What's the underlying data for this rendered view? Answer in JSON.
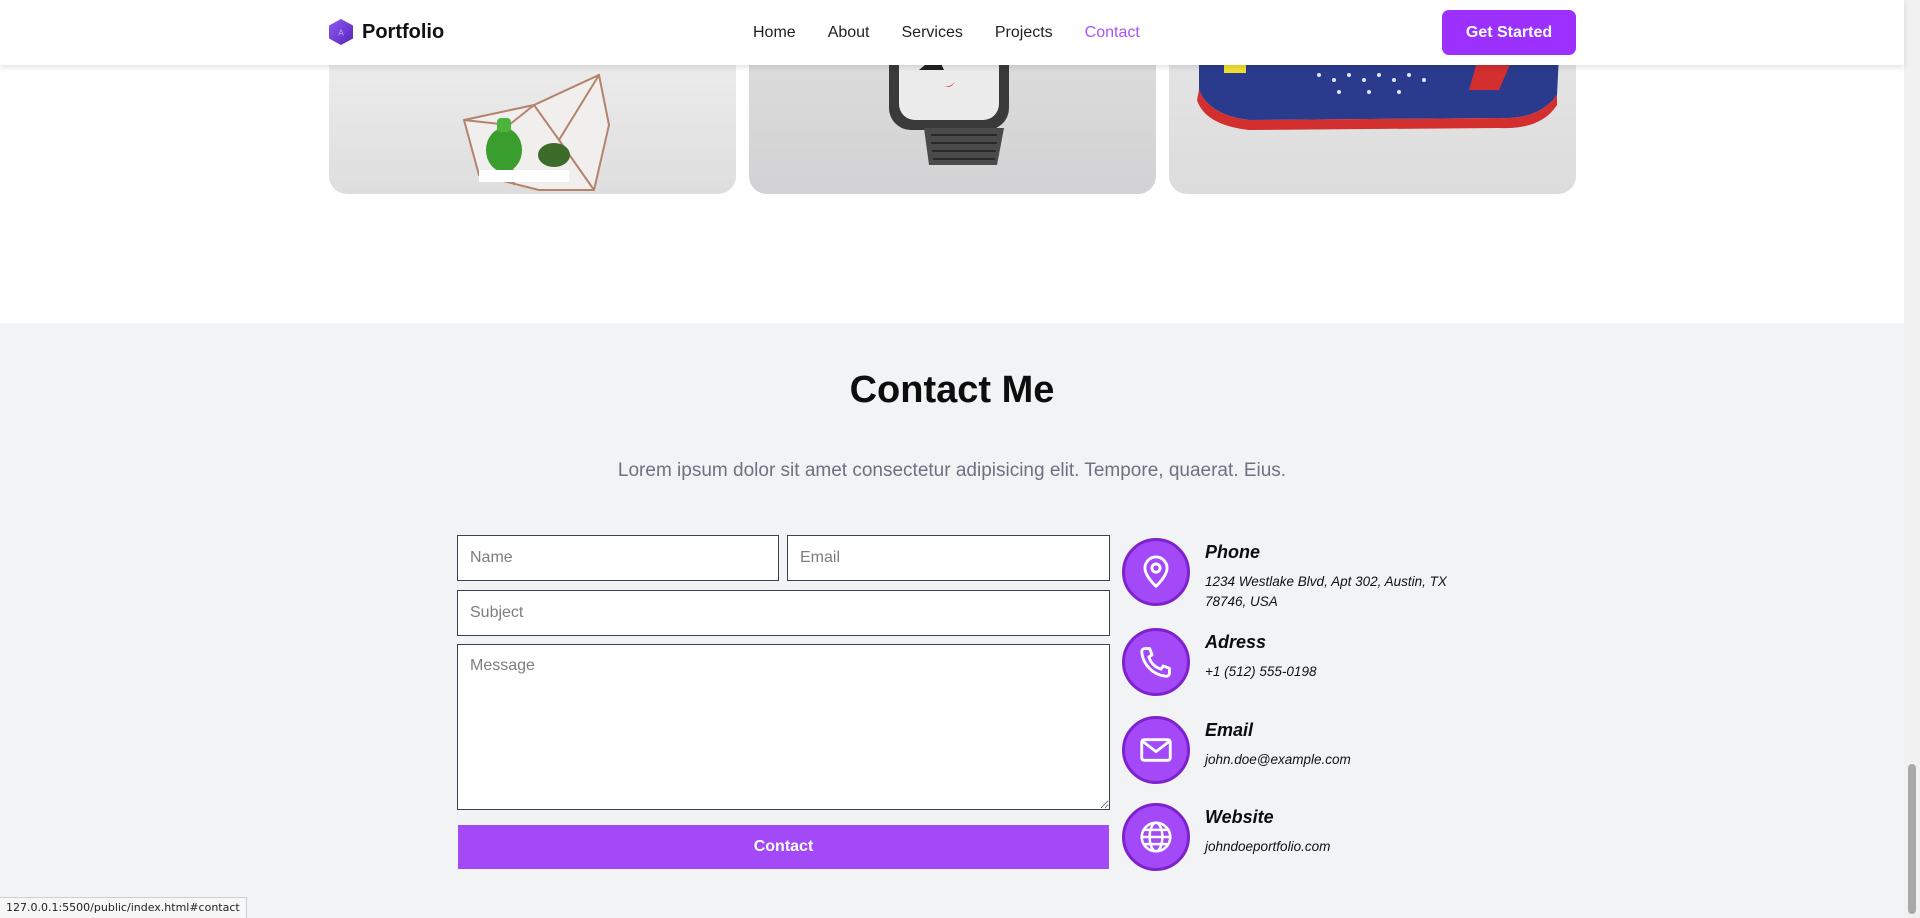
{
  "brand": {
    "name": "Portfolio",
    "logo_icon": "hexagon-logo-icon",
    "logo_mark": "A"
  },
  "nav": {
    "items": [
      {
        "label": "Home",
        "active": false
      },
      {
        "label": "About",
        "active": false
      },
      {
        "label": "Services",
        "active": false
      },
      {
        "label": "Projects",
        "active": false
      },
      {
        "label": "Contact",
        "active": true
      }
    ],
    "active_color": "#a855f7"
  },
  "header": {
    "cta_label": "Get Started",
    "cta_color": "#9b30ff"
  },
  "portfolio": {
    "cards": [
      {
        "image": "geometric-terrarium-image"
      },
      {
        "image": "smartwatch-image"
      },
      {
        "image": "sneaker-image"
      }
    ]
  },
  "contact": {
    "title": "Contact Me",
    "subtitle": "Lorem ipsum dolor sit amet consectetur adipisicing elit. Tempore, quaerat. Eius.",
    "form": {
      "name_placeholder": "Name",
      "email_placeholder": "Email",
      "subject_placeholder": "Subject",
      "message_placeholder": "Message",
      "submit_label": "Contact"
    },
    "accent_color": "#a349f7",
    "info": [
      {
        "icon": "location-pin-icon",
        "title": "Phone",
        "text": "1234 Westlake Blvd, Apt 302, Austin, TX 78746, USA"
      },
      {
        "icon": "phone-icon",
        "title": "Adress",
        "text": "+1 (512) 555-0198"
      },
      {
        "icon": "mail-icon",
        "title": "Email",
        "text": "john.doe@example.com"
      },
      {
        "icon": "globe-icon",
        "title": "Website",
        "text": "johndoeportfolio.com"
      }
    ]
  },
  "status_bar": {
    "url": "127.0.0.1:5500/public/index.html#contact"
  }
}
